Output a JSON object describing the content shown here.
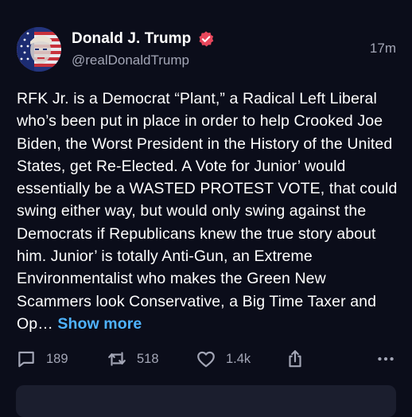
{
  "post": {
    "author_name": "Donald J. Trump",
    "handle": "@realDonaldTrump",
    "time": "17m",
    "text": "RFK Jr. is a Democrat “Plant,” a Radical Left Liberal who’s been put in place in order to help Crooked Joe Biden, the Worst President in the History of the United States, get Re-Elected. A Vote for Junior’ would essentially be a WASTED PROTEST VOTE, that could swing either way, but would only swing against the Democrats if Republicans knew the true story about him. Junior’ is totally Anti-Gun, an Extreme Environmentalist who makes the Green New Scammers look Conservative, a Big Time Taxer and Op…",
    "show_more_label": "Show more"
  },
  "actions": {
    "replies": "189",
    "reposts": "518",
    "likes": "1.4k"
  },
  "icons": [
    "verified-badge-icon",
    "reply-icon",
    "repost-icon",
    "heart-icon",
    "share-icon",
    "more-icon"
  ],
  "colors": {
    "background": "#0b0d1a",
    "text": "#ffffff",
    "muted": "#a3a6b6",
    "link": "#4fb3ff",
    "verified": "#e8475c"
  }
}
